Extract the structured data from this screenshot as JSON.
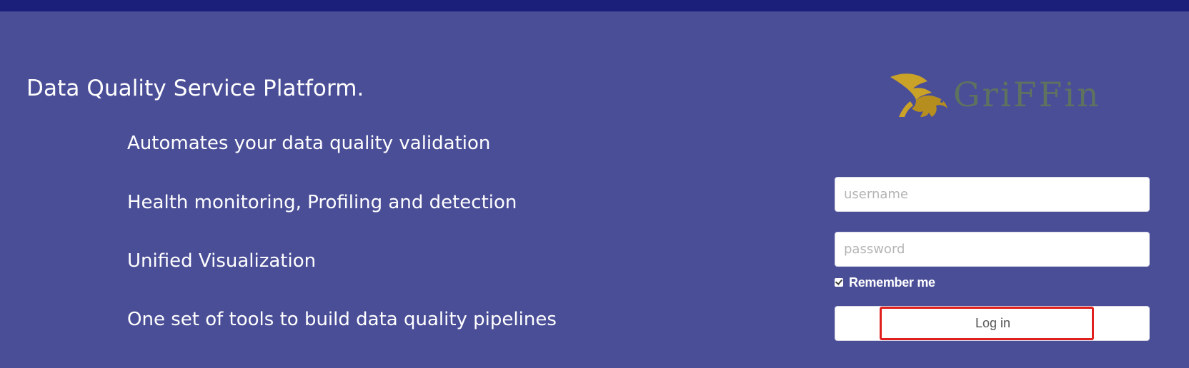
{
  "headline": "Data Quality Service Platform.",
  "features": [
    "Automates your data quality validation",
    "Health monitoring, Profiling and detection",
    "Unified Visualization",
    "One set of tools to build data quality pipelines"
  ],
  "logo": {
    "icon": "griffin-icon",
    "text": "GriFFin",
    "colors": {
      "mark": "#c9a227",
      "text": "#5e7260"
    }
  },
  "login": {
    "username_placeholder": "username",
    "password_placeholder": "password",
    "remember_label": "Remember me",
    "remember_checked": true,
    "button_label": "Log in"
  },
  "colors": {
    "top_bar": "#1b1f7a",
    "background": "#4a4e97",
    "highlight": "#e0201e"
  }
}
